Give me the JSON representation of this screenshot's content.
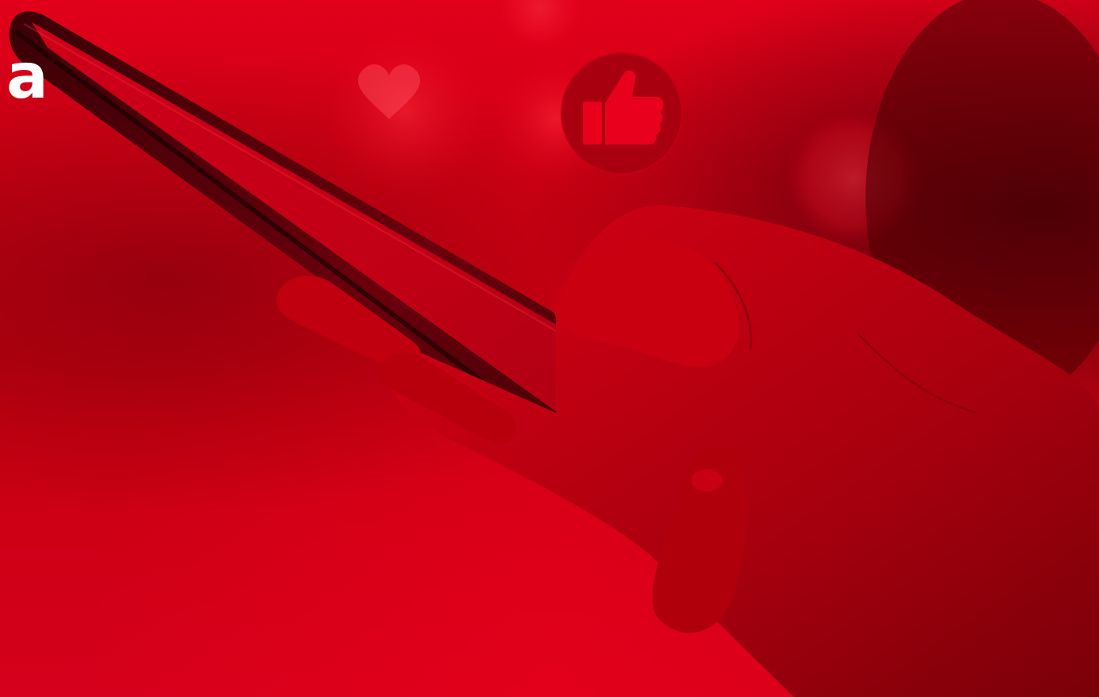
{
  "brand": {
    "logo_text": "a",
    "logo_color": "#ffffff"
  },
  "scene": {
    "description_icons": [
      "heart-icon",
      "thumbs-up-icon"
    ],
    "tint_color": "#d4001a"
  }
}
